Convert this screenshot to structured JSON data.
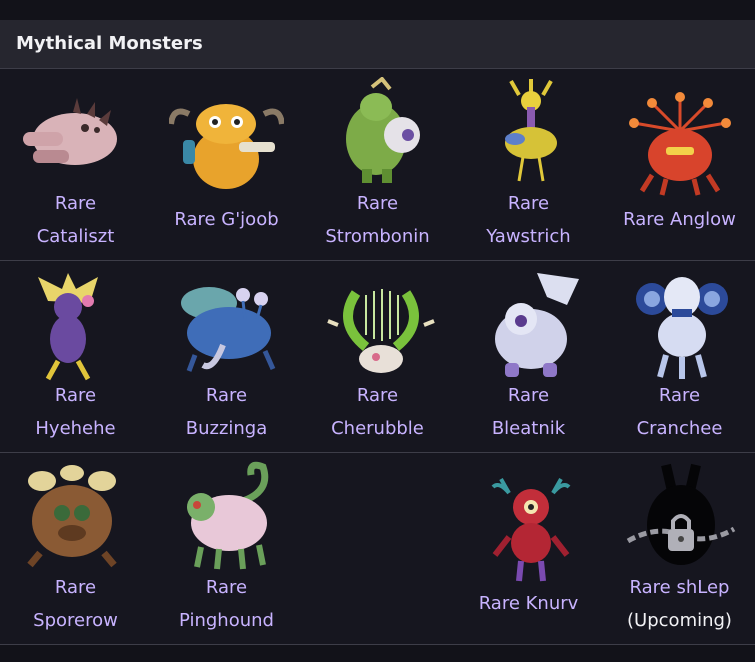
{
  "section": {
    "title": "Mythical Monsters"
  },
  "monsters": [
    {
      "line1": "Rare",
      "line2": "Cataliszt"
    },
    {
      "line1": "Rare G'joob",
      "line2": ""
    },
    {
      "line1": "Rare",
      "line2": "Strombonin"
    },
    {
      "line1": "Rare",
      "line2": "Yawstrich"
    },
    {
      "line1": "Rare Anglow",
      "line2": ""
    },
    {
      "line1": "Rare",
      "line2": "Hyehehe"
    },
    {
      "line1": "Rare",
      "line2": "Buzzinga"
    },
    {
      "line1": "Rare",
      "line2": "Cherubble"
    },
    {
      "line1": "Rare",
      "line2": "Bleatnik"
    },
    {
      "line1": "Rare",
      "line2": "Cranchee"
    },
    {
      "line1": "Rare",
      "line2": "Sporerow"
    },
    {
      "line1": "Rare",
      "line2": "Pinghound"
    },
    {
      "line1": "Rare Knurv",
      "line2": ""
    },
    {
      "line1": "Rare shLep",
      "line2": "(Upcoming)"
    }
  ],
  "colors": {
    "background": "#16161f",
    "header": "#26262f",
    "link": "#c8b3ff",
    "text": "#f2f2f5",
    "divider": "#3d3d48"
  }
}
